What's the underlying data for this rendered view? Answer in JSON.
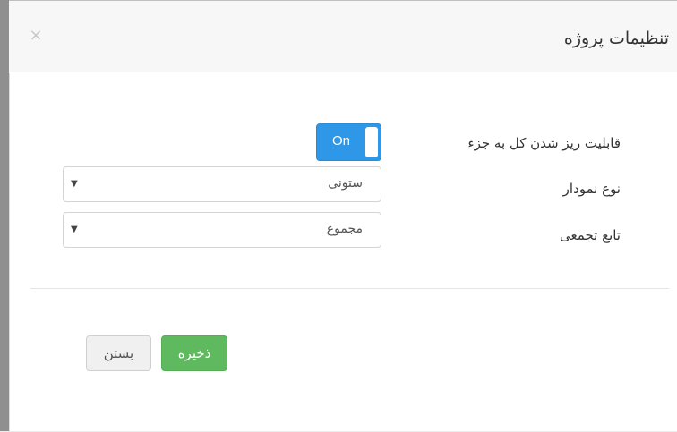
{
  "modal": {
    "title": "تنظیمات پروژه",
    "close_symbol": "×"
  },
  "fields": {
    "drilldown": {
      "label": "قابلیت ریز شدن کل به جزء",
      "toggle_text": "On",
      "toggle_state": "on"
    },
    "chart_type": {
      "label": "نوع نمودار",
      "value": "ستونی",
      "arrow": "▼"
    },
    "aggregate_function": {
      "label": "تابع تجمعی",
      "value": "مجموع",
      "arrow": "▼"
    }
  },
  "buttons": {
    "save_label": "ذخیره",
    "close_label": "بستن"
  },
  "colors": {
    "toggle_on": "#2f97e7",
    "save_button": "#5fb95f"
  }
}
